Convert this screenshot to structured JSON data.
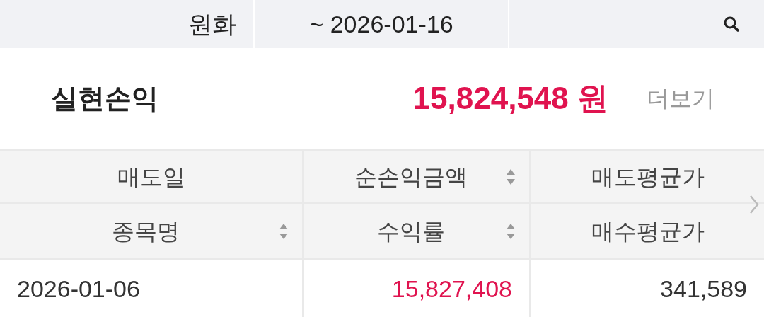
{
  "filter_bar": {
    "currency": "원화",
    "date_range": "~ 2026-01-16"
  },
  "summary": {
    "label": "실현손익",
    "amount": "15,824,548 원",
    "kind": "gain",
    "more_link": "더보기"
  },
  "table": {
    "header_rows": [
      [
        {
          "label": "매도일",
          "sortable": false
        },
        {
          "label": "순손익금액",
          "sortable": true
        },
        {
          "label": "매도평균가",
          "sortable": false
        }
      ],
      [
        {
          "label": "종목명",
          "sortable": true
        },
        {
          "label": "수익률",
          "sortable": true
        },
        {
          "label": "매수평균가",
          "sortable": false
        }
      ]
    ],
    "rows": [
      [
        {
          "text": "2026-01-06",
          "kind": "plain"
        },
        {
          "text": "15,827,408",
          "kind": "gain"
        },
        {
          "text": "341,589",
          "kind": "plain"
        }
      ]
    ]
  }
}
